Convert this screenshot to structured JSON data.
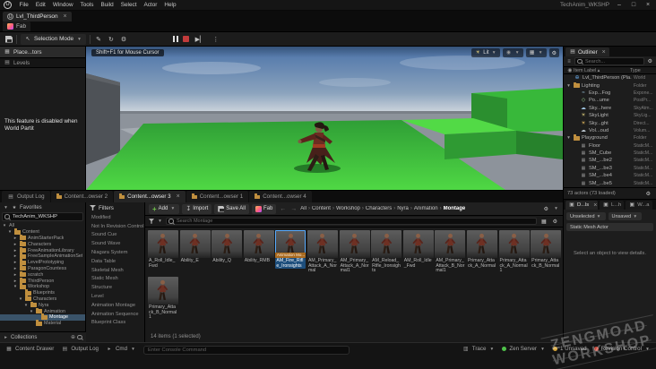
{
  "menu_bar": {
    "items": [
      "File",
      "Edit",
      "Window",
      "Tools",
      "Build",
      "Select",
      "Actor",
      "Help"
    ],
    "project_title": "TechAnim_WKSHP"
  },
  "tabs": {
    "level_tab": "Lvl_ThirdPerson",
    "fab_tab": "Fab"
  },
  "toolbar": {
    "mode_dropdown": "Selection Mode"
  },
  "viewport": {
    "hint": "Shift+F1 for Mouse Cursor",
    "lit_label": "Lit"
  },
  "left_panel": {
    "tab_place": "Place...tors",
    "tab_levels": "Levels",
    "message": "This feature is disabled when World Partit"
  },
  "outliner": {
    "title": "Outliner",
    "search_placeholder": "Search...",
    "col_label": "Item Label",
    "col_type": "Type",
    "footer": "73 actors (73 loaded)",
    "rows": [
      {
        "indent": 0,
        "caret": "",
        "icon": "world",
        "label": "Lvl_ThirdPerson (Pla...",
        "type": "World"
      },
      {
        "indent": 0,
        "caret": "▾",
        "icon": "folder",
        "label": "Lighting",
        "type": "Folder"
      },
      {
        "indent": 1,
        "caret": "",
        "icon": "fog",
        "label": "Exp...Fog",
        "type": "Expone..."
      },
      {
        "indent": 1,
        "caret": "",
        "icon": "volume",
        "label": "Po...ume",
        "type": "PostPr..."
      },
      {
        "indent": 1,
        "caret": "",
        "icon": "atmos",
        "label": "Sky...here",
        "type": "SkyAtm..."
      },
      {
        "indent": 1,
        "caret": "",
        "icon": "skylight",
        "label": "SkyLight",
        "type": "SkyLig..."
      },
      {
        "indent": 1,
        "caret": "",
        "icon": "dirlight",
        "label": "Sky...ght",
        "type": "Direct..."
      },
      {
        "indent": 1,
        "caret": "",
        "icon": "cloud",
        "label": "Vol...oud",
        "type": "Volum..."
      },
      {
        "indent": 0,
        "caret": "▾",
        "icon": "folder",
        "label": "Playground",
        "type": "Folder"
      },
      {
        "indent": 1,
        "caret": "",
        "icon": "cube",
        "label": "Floor",
        "type": "StaticM..."
      },
      {
        "indent": 1,
        "caret": "",
        "icon": "cube",
        "label": "SM_Cube",
        "type": "StaticM..."
      },
      {
        "indent": 1,
        "caret": "",
        "icon": "cube",
        "label": "SM_...be2",
        "type": "StaticM..."
      },
      {
        "indent": 1,
        "caret": "",
        "icon": "cube",
        "label": "SM_...be3",
        "type": "StaticM..."
      },
      {
        "indent": 1,
        "caret": "",
        "icon": "cube",
        "label": "SM_...be4",
        "type": "StaticM..."
      },
      {
        "indent": 1,
        "caret": "",
        "icon": "cube",
        "label": "SM_...be5",
        "type": "StaticM..."
      }
    ]
  },
  "details": {
    "tabs": [
      "D...ls",
      "L...h",
      "W...a"
    ],
    "pill1": "Unselected",
    "pill2": "Unsaved",
    "pill3": "Static Mesh Actor",
    "empty_message": "Select an object to view details."
  },
  "bottom_tabs": [
    {
      "label": "Output Log",
      "icon": "log",
      "active": false
    },
    {
      "label": "Content...owser 2",
      "icon": "folder",
      "active": false
    },
    {
      "label": "Content...owser 3",
      "icon": "folder",
      "active": true
    },
    {
      "label": "Content...owser 1",
      "icon": "folder",
      "active": false
    },
    {
      "label": "Content...owser 4",
      "icon": "folder",
      "active": false
    }
  ],
  "content_browser": {
    "add": "Add",
    "import": "Import",
    "save_all": "Save All",
    "fab": "Fab",
    "breadcrumb": [
      "All",
      "Content",
      "Workshop",
      "Characters",
      "Nyra",
      "Animation",
      "Montage"
    ],
    "search_placeholder": "Search Montage",
    "favorites": "Favorites",
    "project_row": "TechAnim_WKSHP",
    "collections": "Collections",
    "filters_title": "Filters",
    "filters": [
      "Modified",
      "Not In Revision Control",
      "Sound Cue",
      "Sound Wave",
      "Niagara System",
      "Data Table",
      "Skeletal Mesh",
      "Static Mesh",
      "Structure",
      "Level",
      "Animation Montage",
      "Animation Sequence",
      "Blueprint Class"
    ],
    "tree": [
      {
        "indent": 0,
        "caret": "▾",
        "icon": "",
        "label": "All"
      },
      {
        "indent": 1,
        "caret": "▾",
        "icon": "folder",
        "label": "Content"
      },
      {
        "indent": 2,
        "caret": "▸",
        "icon": "folder",
        "label": "AnimStarterPack"
      },
      {
        "indent": 2,
        "caret": "▸",
        "icon": "folder",
        "label": "Characters"
      },
      {
        "indent": 2,
        "caret": "▸",
        "icon": "folder",
        "label": "FreeAnimationLibrary"
      },
      {
        "indent": 2,
        "caret": "▸",
        "icon": "folder",
        "label": "FreeSampleAnimationSet"
      },
      {
        "indent": 2,
        "caret": "▸",
        "icon": "folder",
        "label": "LevelPrototyping"
      },
      {
        "indent": 2,
        "caret": "▸",
        "icon": "folder",
        "label": "ParagonCountess"
      },
      {
        "indent": 2,
        "caret": "▸",
        "icon": "folder",
        "label": "scratch"
      },
      {
        "indent": 2,
        "caret": "▸",
        "icon": "folder",
        "label": "ThirdPerson"
      },
      {
        "indent": 2,
        "caret": "▾",
        "icon": "folder",
        "label": "Workshop"
      },
      {
        "indent": 3,
        "caret": "",
        "icon": "folder",
        "label": "Blueprints"
      },
      {
        "indent": 3,
        "caret": "▾",
        "icon": "folder",
        "label": "Characters"
      },
      {
        "indent": 4,
        "caret": "▾",
        "icon": "folder",
        "label": "Nyra"
      },
      {
        "indent": 5,
        "caret": "▾",
        "icon": "folder",
        "label": "Animation"
      },
      {
        "indent": 6,
        "caret": "",
        "icon": "folder",
        "label": "Montage",
        "selected": true
      },
      {
        "indent": 5,
        "caret": "",
        "icon": "folder",
        "label": "Material"
      }
    ],
    "assets": [
      {
        "name": "A_Roll_Idle_Fwd"
      },
      {
        "name": "Ability_E"
      },
      {
        "name": "Ability_Q"
      },
      {
        "name": "Ability_RMB"
      },
      {
        "name": "AM_Fire_Rifle_Ironsights",
        "selected": true
      },
      {
        "name": "AM_Primary_Attack_A_Normal"
      },
      {
        "name": "AM_Primary_Attack_A_Normal1"
      },
      {
        "name": "AM_Reload_Rifle_Ironsights"
      },
      {
        "name": "AM_Roll_Idle_Fwd"
      },
      {
        "name": "AM_Primary_Attack_B_Normal1"
      },
      {
        "name": "Primary_Attack_A_Normal"
      },
      {
        "name": "Primary_Attack_A_Normal1"
      },
      {
        "name": "Primary_Attack_B_Normal"
      },
      {
        "name": "Primary_Attack_B_Normal1"
      }
    ],
    "selected_badge": "Animation Mo...",
    "items_status": "14 items (1 selected)"
  },
  "status_bar": {
    "content_drawer": "Content Drawer",
    "output_log": "Output Log",
    "cmd": "Cmd",
    "console_placeholder": "Enter Console Command",
    "trace": "Trace",
    "zen": "Zen Server",
    "unsaved": "1 Unsaved",
    "revision": "Revision Control"
  },
  "watermark": {
    "line1": "ZENGMOAD",
    "line2": "WORKSHOP"
  }
}
